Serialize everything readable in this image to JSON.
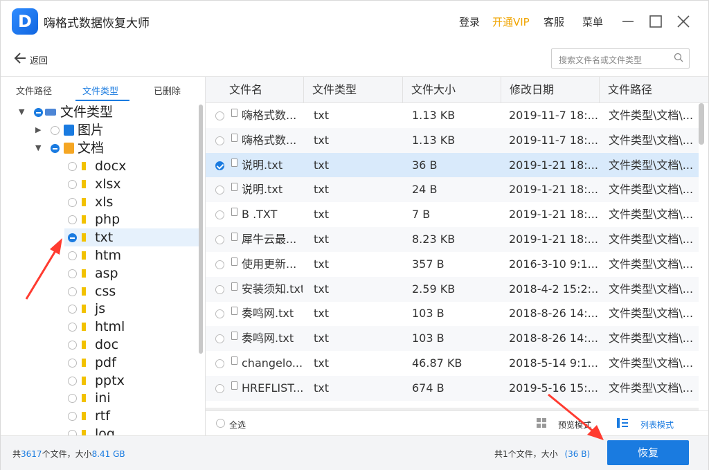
{
  "app": {
    "title": "嗨格式数据恢复大师",
    "logo_letter": "D"
  },
  "titlebar": {
    "login": "登录",
    "vip": "开通VIP",
    "service": "客服",
    "menu": "菜单"
  },
  "nav": {
    "back_label": "返回",
    "search_placeholder": "搜索文件名或文件类型"
  },
  "left_tabs": [
    {
      "label": "文件路径",
      "active": false
    },
    {
      "label": "文件类型",
      "active": true
    },
    {
      "label": "已删除",
      "active": false
    }
  ],
  "tree": {
    "root": "文件类型",
    "images": "图片",
    "documents": "文档",
    "ext": [
      "docx",
      "xlsx",
      "xls",
      "php",
      "txt",
      "htm",
      "asp",
      "css",
      "js",
      "html",
      "doc",
      "pdf",
      "pptx",
      "ini",
      "rtf",
      "log"
    ],
    "selected": "txt"
  },
  "table": {
    "headers": [
      "文件名",
      "文件类型",
      "文件大小",
      "修改日期",
      "文件路径"
    ],
    "rows": [
      {
        "name": "嗨格式数...",
        "type": "txt",
        "size": "1.13 KB",
        "date": "2019-11-7 18:...",
        "path": "文件类型\\文档\\..."
      },
      {
        "name": "嗨格式数...",
        "type": "txt",
        "size": "1.13 KB",
        "date": "2019-11-7 18:...",
        "path": "文件类型\\文档\\..."
      },
      {
        "name": "说明.txt",
        "type": "txt",
        "size": "36 B",
        "date": "2019-1-21 18:...",
        "path": "文件类型\\文档\\..."
      },
      {
        "name": "说明.txt",
        "type": "txt",
        "size": "24 B",
        "date": "2019-1-21 18:...",
        "path": "文件类型\\文档\\..."
      },
      {
        "name": "B       .TXT",
        "type": "txt",
        "size": "7 B",
        "date": "2019-1-21 18:...",
        "path": "文件类型\\文档\\..."
      },
      {
        "name": "犀牛云最...",
        "type": "txt",
        "size": "8.23 KB",
        "date": "2019-1-21 18:...",
        "path": "文件类型\\文档\\..."
      },
      {
        "name": "使用更新...",
        "type": "txt",
        "size": "357 B",
        "date": "2016-3-10 9:1...",
        "path": "文件类型\\文档\\..."
      },
      {
        "name": "安装须知.txt",
        "type": "txt",
        "size": "2.59 KB",
        "date": "2018-4-2 15:2:...",
        "path": "文件类型\\文档\\..."
      },
      {
        "name": "奏鸣网.txt",
        "type": "txt",
        "size": "103 B",
        "date": "2018-8-26 14:...",
        "path": "文件类型\\文档\\..."
      },
      {
        "name": "奏鸣网.txt",
        "type": "txt",
        "size": "103 B",
        "date": "2018-8-26 14:...",
        "path": "文件类型\\文档\\..."
      },
      {
        "name": "changelo...",
        "type": "txt",
        "size": "46.87 KB",
        "date": "2018-5-14 9:1...",
        "path": "文件类型\\文档\\..."
      },
      {
        "name": "HREFLIST...",
        "type": "txt",
        "size": "674 B",
        "date": "2019-5-16 15:...",
        "path": "文件类型\\文档\\..."
      }
    ],
    "selected_row": 2
  },
  "bottom": {
    "select_all": "全选",
    "preview_mode": "预览模式",
    "list_mode": "列表模式"
  },
  "status": {
    "total_prefix": "共",
    "total_count": "3617",
    "total_mid": "个文件，大小",
    "total_size": "8.41 GB",
    "sel_text": "共1个文件，大小",
    "sel_size": "(36 B)",
    "recover": "恢复"
  },
  "colors": {
    "accent": "#1a7be0",
    "vip": "#f0a400",
    "arrow": "#ff3b30"
  }
}
